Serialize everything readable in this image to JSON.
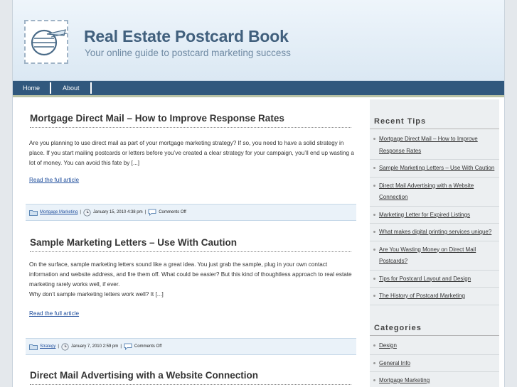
{
  "site": {
    "title": "Real Estate Postcard Book",
    "tagline": "Your online guide to postcard marketing success"
  },
  "nav": {
    "items": [
      {
        "label": "Home"
      },
      {
        "label": "About"
      }
    ]
  },
  "posts": [
    {
      "title": "Mortgage Direct Mail – How to Improve Response Rates",
      "body": "Are you planning to use direct mail as part of your mortgage marketing strategy? If so, you need to have a solid strategy in place. If you start mailing postcards or letters before you’ve created a clear strategy for your campaign, you’ll end up wasting a lot of money. You can avoid this fate by [...]",
      "read_more": "Read the full article",
      "category": "Mortgage Marketing",
      "date": "January 15, 2010 4:38 pm",
      "comments": "Comments Off"
    },
    {
      "title": "Sample Marketing Letters – Use With Caution",
      "body_lines": [
        "On the surface, sample marketing letters sound like a great idea. You just grab the sample, plug in your own contact information and website address, and fire them off. What could be easier? But this kind of thoughtless approach to real estate marketing rarely works well, if ever.",
        "Why don’t sample marketing letters work well? It [...]"
      ],
      "read_more": "Read the full article",
      "category": "Strategy",
      "date": "January 7, 2010 2:59 pm",
      "comments": "Comments Off"
    },
    {
      "title": "Direct Mail Advertising with a Website Connection"
    }
  ],
  "sidebar": {
    "recent_tips": {
      "title": "Recent Tips",
      "items": [
        "Mortgage Direct Mail – How to Improve Response Rates",
        "Sample Marketing Letters – Use With Caution",
        "Direct Mail Advertising with a Website Connection",
        "Marketing Letter for Expired Listings",
        "What makes digital printing services unique?",
        "Are You Wasting Money on Direct Mail Postcards?",
        "Tips for Postcard Layout and Design",
        "The History of Postcard Marketing"
      ]
    },
    "categories": {
      "title": "Categories",
      "items": [
        "Design",
        "General Info",
        "Mortgage Marketing"
      ]
    }
  },
  "icons": {
    "logo": "postage-stamp-icon",
    "category": "folder-icon",
    "date": "clock-icon",
    "comments": "speech-bubble-icon"
  },
  "colors": {
    "nav_bg": "#31587d",
    "title_blue": "#41607d",
    "link_blue": "#1f4e9c",
    "meta_bg": "#eaf2f9"
  }
}
